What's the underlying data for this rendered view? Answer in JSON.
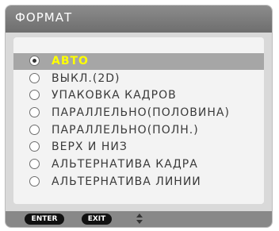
{
  "dialog": {
    "title": "ФОРМАТ",
    "options": [
      {
        "label": "АВТО",
        "selected": true
      },
      {
        "label": "ВЫКЛ.(2D)",
        "selected": false
      },
      {
        "label": "УПАКОВКА КАДРОВ",
        "selected": false
      },
      {
        "label": "ПАРАЛЛЕЛЬНО(ПОЛОВИНА)",
        "selected": false
      },
      {
        "label": "ПАРАЛЛЕЛЬНО(ПОЛН.)",
        "selected": false
      },
      {
        "label": "ВЕРХ И НИЗ",
        "selected": false
      },
      {
        "label": "АЛЬТЕРНАТИВА КАДРА",
        "selected": false
      },
      {
        "label": "АЛЬТЕРНАТИВА ЛИНИИ",
        "selected": false
      }
    ]
  },
  "footer": {
    "enter_label": "ENTER",
    "exit_label": "EXIT",
    "nav_icon": "up-down-arrows-icon"
  },
  "colors": {
    "selected_text": "#ffff00",
    "selected_bg": "#a6a6a6",
    "titlebar": "#7a7a7a"
  }
}
